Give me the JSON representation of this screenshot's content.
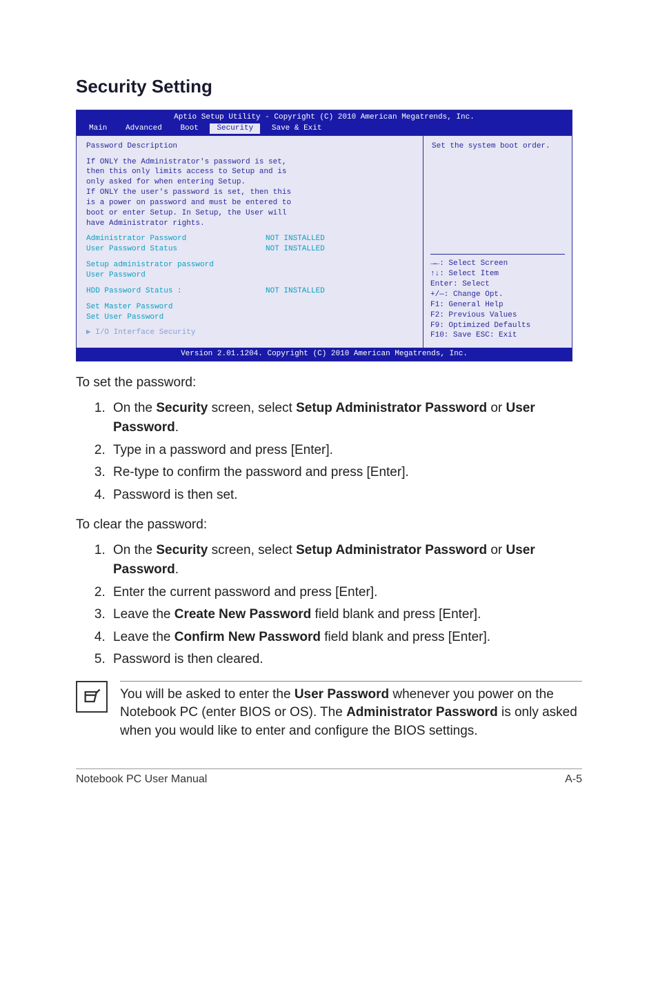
{
  "heading": "Security Setting",
  "bios": {
    "title": "Aptio Setup Utility - Copyright (C) 2010 American Megatrends, Inc.",
    "tabs": [
      "Main",
      "Advanced",
      "Boot",
      "Security",
      "Save & Exit"
    ],
    "active_tab": "Security",
    "left": {
      "pw_desc_label": "Password Description",
      "desc_lines": [
        "If ONLY the Administrator's password is set,",
        "then this only limits access to Setup and is",
        "only asked for when entering Setup.",
        "If ONLY the user's password is set, then this",
        "is a power on password and must be entered to",
        "boot or enter Setup. In Setup, the User will",
        "have Administrator rights."
      ],
      "admin_pw_label": "Administrator Password",
      "admin_pw_value": "NOT INSTALLED",
      "user_pw_label": "User Password Status",
      "user_pw_value": "NOT INSTALLED",
      "setup_admin_pw": "Setup administrator password",
      "user_pw_item": "User Password",
      "hdd_pw_label": "HDD Password Status :",
      "hdd_pw_value": "NOT INSTALLED",
      "set_master": "Set Master Password",
      "set_user": "Set User Password",
      "io_sec": "I/O Interface Security"
    },
    "right": {
      "help": "Set the system boot order.",
      "hints": [
        "→←: Select Screen",
        "↑↓:   Select Item",
        "Enter: Select",
        "+/—:  Change Opt.",
        "F1:   General Help",
        "F2:   Previous Values",
        "F9:   Optimized Defaults",
        "F10:  Save   ESC: Exit"
      ]
    },
    "footer": "Version 2.01.1204. Copyright (C) 2010 American Megatrends, Inc."
  },
  "to_set_intro": "To set the password:",
  "to_set_steps": [
    {
      "pre": "On the ",
      "b1": "Security",
      "mid": " screen, select ",
      "b2": "Setup Administrator Password",
      "post": " or ",
      "b3": "User Password",
      "tail": "."
    },
    {
      "text": "Type in a password and press [Enter]."
    },
    {
      "text": "Re-type to confirm the password and press [Enter]."
    },
    {
      "text": "Password is then set."
    }
  ],
  "to_clear_intro": "To clear the password:",
  "to_clear_steps": [
    {
      "pre": "On the ",
      "b1": "Security",
      "mid": " screen, select ",
      "b2": "Setup Administrator Password",
      "post": " or ",
      "b3": "User Password",
      "tail": "."
    },
    {
      "text": "Enter the current password and press [Enter]."
    },
    {
      "pre": "Leave the ",
      "b1": "Create New Password",
      "post": " field blank and press [Enter]."
    },
    {
      "pre": "Leave the ",
      "b1": "Confirm New Password",
      "post": " field blank and press [Enter]."
    },
    {
      "text": "Password is then cleared."
    }
  ],
  "note": {
    "pre": "You will be asked to enter the ",
    "b1": "User Password",
    "mid": " whenever you power on the Notebook PC (enter BIOS or OS). The ",
    "b2": "Administrator Password",
    "post": " is only asked when you would like to enter and configure the BIOS settings."
  },
  "footer_left": "Notebook PC User Manual",
  "footer_right": "A-5"
}
